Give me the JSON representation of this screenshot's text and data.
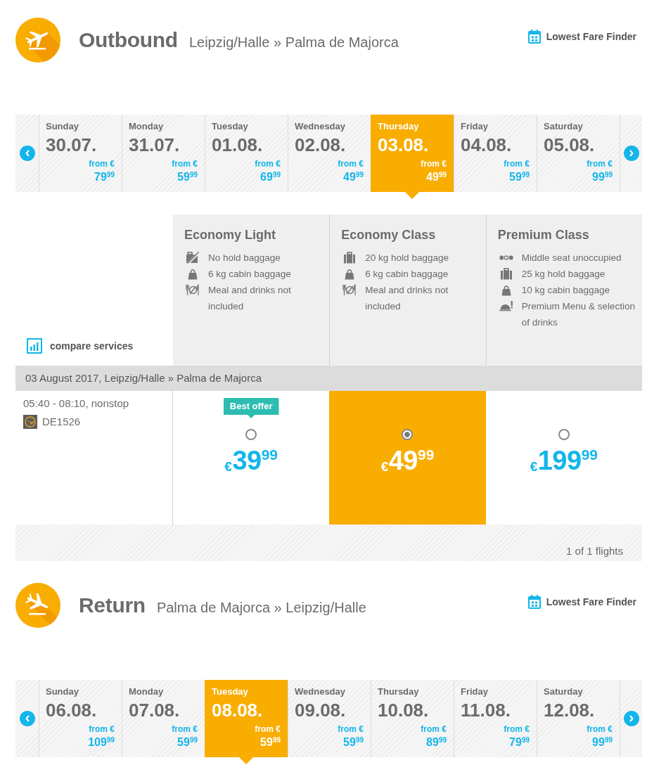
{
  "legs": [
    {
      "kind": "departure",
      "title": "Outbound",
      "route": "Leipzig/Halle » Palma de Majorca",
      "fare_finder": "Lowest Fare Finder",
      "days": [
        {
          "day": "Sunday",
          "date": "30.07.",
          "from": "from €",
          "price": "79$^{99}$",
          "selected": false
        },
        {
          "day": "Monday",
          "date": "31.07.",
          "from": "from €",
          "price": "59$^{99}$",
          "selected": false
        },
        {
          "day": "Tuesday",
          "date": "01.08.",
          "from": "from €",
          "price": "69$^{99}$",
          "selected": false
        },
        {
          "day": "Wednesday",
          "date": "02.08.",
          "from": "from €",
          "price": "49$^{99}$",
          "selected": false
        },
        {
          "day": "Thursday",
          "date": "03.08.",
          "from": "from €",
          "price": "49$^{99}$",
          "selected": true
        },
        {
          "day": "Friday",
          "date": "04.08.",
          "from": "from €",
          "price": "59$^{99}$",
          "selected": false
        },
        {
          "day": "Saturday",
          "date": "05.08.",
          "from": "from €",
          "price": "99$^{99}$",
          "selected": false
        }
      ],
      "fare_classes": {
        "compare_link": "compare services",
        "classes": [
          {
            "name": "Economy Light",
            "features": [
              {
                "kind": "no-hold-baggage",
                "text": "No hold baggage"
              },
              {
                "kind": "cabin-baggage",
                "text": "6 kg cabin baggage"
              },
              {
                "kind": "no-meal",
                "text": "Meal and drinks not included"
              }
            ]
          },
          {
            "name": "Economy Class",
            "features": [
              {
                "kind": "hold-baggage",
                "text": "20 kg hold baggage"
              },
              {
                "kind": "cabin-baggage",
                "text": "6 kg cabin baggage"
              },
              {
                "kind": "no-meal",
                "text": "Meal and drinks not included"
              }
            ]
          },
          {
            "name": "Premium Class",
            "features": [
              {
                "kind": "seat",
                "text": "Middle seat unoccupied"
              },
              {
                "kind": "hold-baggage",
                "text": "25 kg hold baggage"
              },
              {
                "kind": "cabin-baggage",
                "text": "10 kg cabin baggage"
              },
              {
                "kind": "meal",
                "text": "Premium Menu & selection of drinks"
              }
            ]
          }
        ]
      },
      "flight": {
        "header": "03 August 2017, Leipzig/Halle » Palma de Majorca",
        "times": "05:40 - 08:10, nonstop",
        "flight_number": "DE1526",
        "fares": [
          {
            "badge": "Best offer",
            "price": "$_{€}$39$^{99}$",
            "selected": false
          },
          {
            "price": "$_{€}$49$^{99}$",
            "selected": true
          },
          {
            "price": "$_{€}$199$^{99}$",
            "selected": false
          }
        ],
        "count": "1 of 1 flights"
      }
    },
    {
      "kind": "arrival",
      "title": "Return",
      "route": "Palma de Majorca » Leipzig/Halle",
      "fare_finder": "Lowest Fare Finder",
      "days": [
        {
          "day": "Sunday",
          "date": "06.08.",
          "from": "from €",
          "price": "109$^{99}$",
          "selected": false
        },
        {
          "day": "Monday",
          "date": "07.08.",
          "from": "from €",
          "price": "59$^{99}$",
          "selected": false
        },
        {
          "day": "Tuesday",
          "date": "08.08.",
          "from": "from €",
          "price": "59$^{99}$",
          "selected": true
        },
        {
          "day": "Wednesday",
          "date": "09.08.",
          "from": "from €",
          "price": "59$^{99}$",
          "selected": false
        },
        {
          "day": "Thursday",
          "date": "10.08.",
          "from": "from €",
          "price": "89$^{99}$",
          "selected": false
        },
        {
          "day": "Friday",
          "date": "11.08.",
          "from": "from €",
          "price": "79$^{99}$",
          "selected": false
        },
        {
          "day": "Saturday",
          "date": "12.08.",
          "from": "from €",
          "price": "99$^{99}$",
          "selected": false
        }
      ]
    }
  ]
}
